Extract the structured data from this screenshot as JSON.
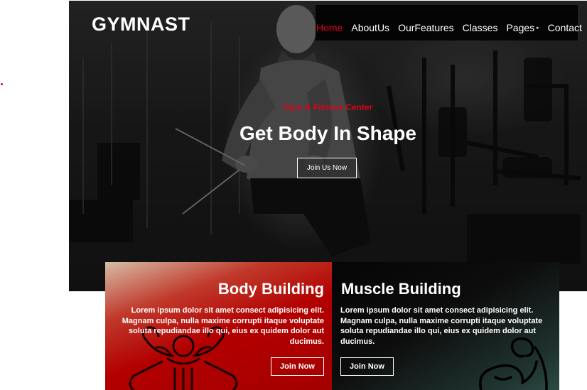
{
  "brand": "GYMNAST",
  "nav": {
    "items": [
      {
        "label": "Home",
        "active": true
      },
      {
        "label": "AboutUs"
      },
      {
        "label": "OurFeatures"
      },
      {
        "label": "Classes"
      },
      {
        "label": "Pages",
        "caret": "▸"
      },
      {
        "label": "Contact"
      }
    ]
  },
  "hero": {
    "subtitle": "Gym & Fitness Center",
    "title": "Get Body In Shape",
    "button": "Join Us Now"
  },
  "cards": [
    {
      "title": "Body Building",
      "text": "Lorem ipsum dolor sit amet consect adipisicing elit. Magnam culpa, nulla maxime corrupti itaque voluptate soluta repudiandae illo qui, eius ex quidem dolor aut ducimus.",
      "button": "Join Now",
      "icon": "bodybuilder-icon"
    },
    {
      "title": "Muscle Building",
      "text": "Lorem ipsum dolor sit amet consect adipisicing elit. Magnam culpa, nulla maxime corrupti itaque voluptate soluta repudiandae illo qui, eius ex quidem dolor aut ducimus.",
      "button": "Join Now",
      "icon": "flexed-arm-icon"
    }
  ],
  "colors": {
    "accent": "#e0001a",
    "card_left": "#b30000",
    "card_right": "#0d0d0d"
  }
}
